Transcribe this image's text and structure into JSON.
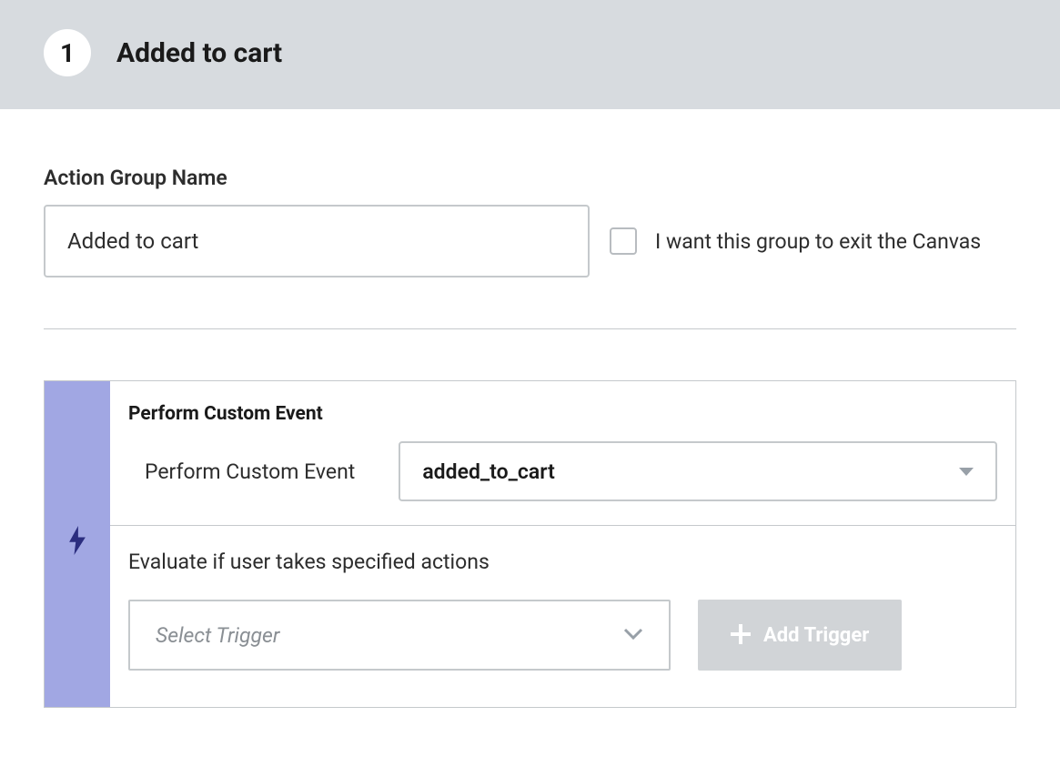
{
  "header": {
    "step_number": "1",
    "title": "Added to cart"
  },
  "form": {
    "name_label": "Action Group Name",
    "name_value": "Added to cart",
    "exit_checkbox_label": "I want this group to exit the Canvas"
  },
  "event": {
    "section_title": "Perform Custom Event",
    "row_label": "Perform Custom Event",
    "selected_value": "added_to_cart",
    "evaluate_label": "Evaluate if user takes specified actions",
    "trigger_placeholder": "Select Trigger",
    "add_trigger_label": "Add Trigger"
  }
}
